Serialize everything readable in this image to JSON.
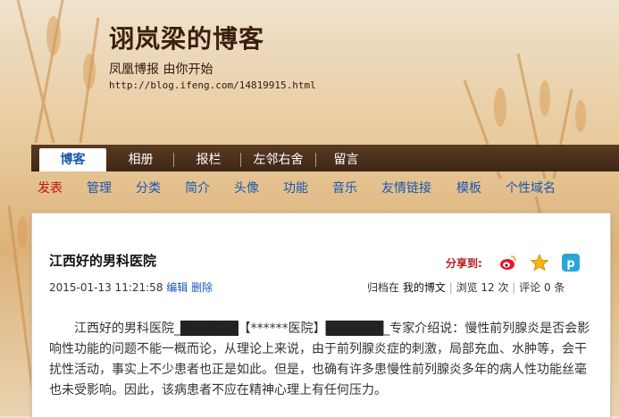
{
  "blog": {
    "title": "诩岚梁的博客",
    "subtitle": "凤凰博报 由你开始",
    "url": "http://blog.ifeng.com/14819915.html"
  },
  "nav": {
    "tabs": [
      {
        "label": "博客"
      },
      {
        "label": "相册"
      },
      {
        "label": "报栏"
      },
      {
        "label": "左邻右舍"
      },
      {
        "label": "留言"
      }
    ]
  },
  "subnav": {
    "items": [
      {
        "label": "发表"
      },
      {
        "label": "管理"
      },
      {
        "label": "分类"
      },
      {
        "label": "简介"
      },
      {
        "label": "头像"
      },
      {
        "label": "功能"
      },
      {
        "label": "音乐"
      },
      {
        "label": "友情链接"
      },
      {
        "label": "模板"
      },
      {
        "label": "个性域名"
      }
    ]
  },
  "post": {
    "title": "江西好的男科医院",
    "share_label": "分享到:",
    "date": "2015-01-13 11:21:58",
    "edit": "编辑",
    "delete": "删除",
    "category_prefix": "归档在",
    "category": "我的博文",
    "views": "浏览 12 次",
    "comments": "评论 0 条",
    "body_1": "江西好的男科医院_",
    "censor_1": "██████",
    "body_2": "【******医院】",
    "censor_2": "██████",
    "body_3": "_专家介绍说：慢性前列腺炎是否会影响性功能的问题不能一概而论，从理论上来说，由于前列腺炎症的刺激，局部充血、水肿等，会干扰性活动，事实上不少患者也正是如此。但是，也确有许多患慢性前列腺炎多年的病人性功能丝毫也未受影响。因此，该病患者不应在精神心理上有任何压力。"
  },
  "colors": {
    "link": "#1a56b3",
    "accent_red": "#c0140f",
    "nav_bg": "#4a2e1a"
  },
  "icons": [
    "weibo-icon",
    "star-icon",
    "qzone-icon"
  ]
}
